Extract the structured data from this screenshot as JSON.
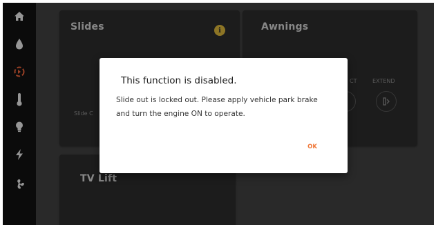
{
  "sidebar": {
    "items": [
      {
        "icon": "home-icon"
      },
      {
        "icon": "water-drop-icon"
      },
      {
        "icon": "slide-out-icon",
        "active": true
      },
      {
        "icon": "thermometer-icon"
      },
      {
        "icon": "lightbulb-icon"
      },
      {
        "icon": "lightning-icon"
      },
      {
        "icon": "fan-icon"
      }
    ],
    "active_color": "#e8623a"
  },
  "cards": {
    "slides": {
      "title": "Slides",
      "info_badge": "i",
      "item_label": "Slide C"
    },
    "awnings": {
      "title": "Awnings",
      "retract_label": "CT",
      "extend_label": "EXTEND"
    },
    "tv_lift": {
      "title": "TV Lift"
    }
  },
  "dialog": {
    "title": "This function is disabled.",
    "body_line1": "Slide out is locked out. Please apply vehicle park brake",
    "body_line2": "and turn the engine ON to operate.",
    "ok_label": "OK",
    "accent_color": "#f0793a"
  }
}
